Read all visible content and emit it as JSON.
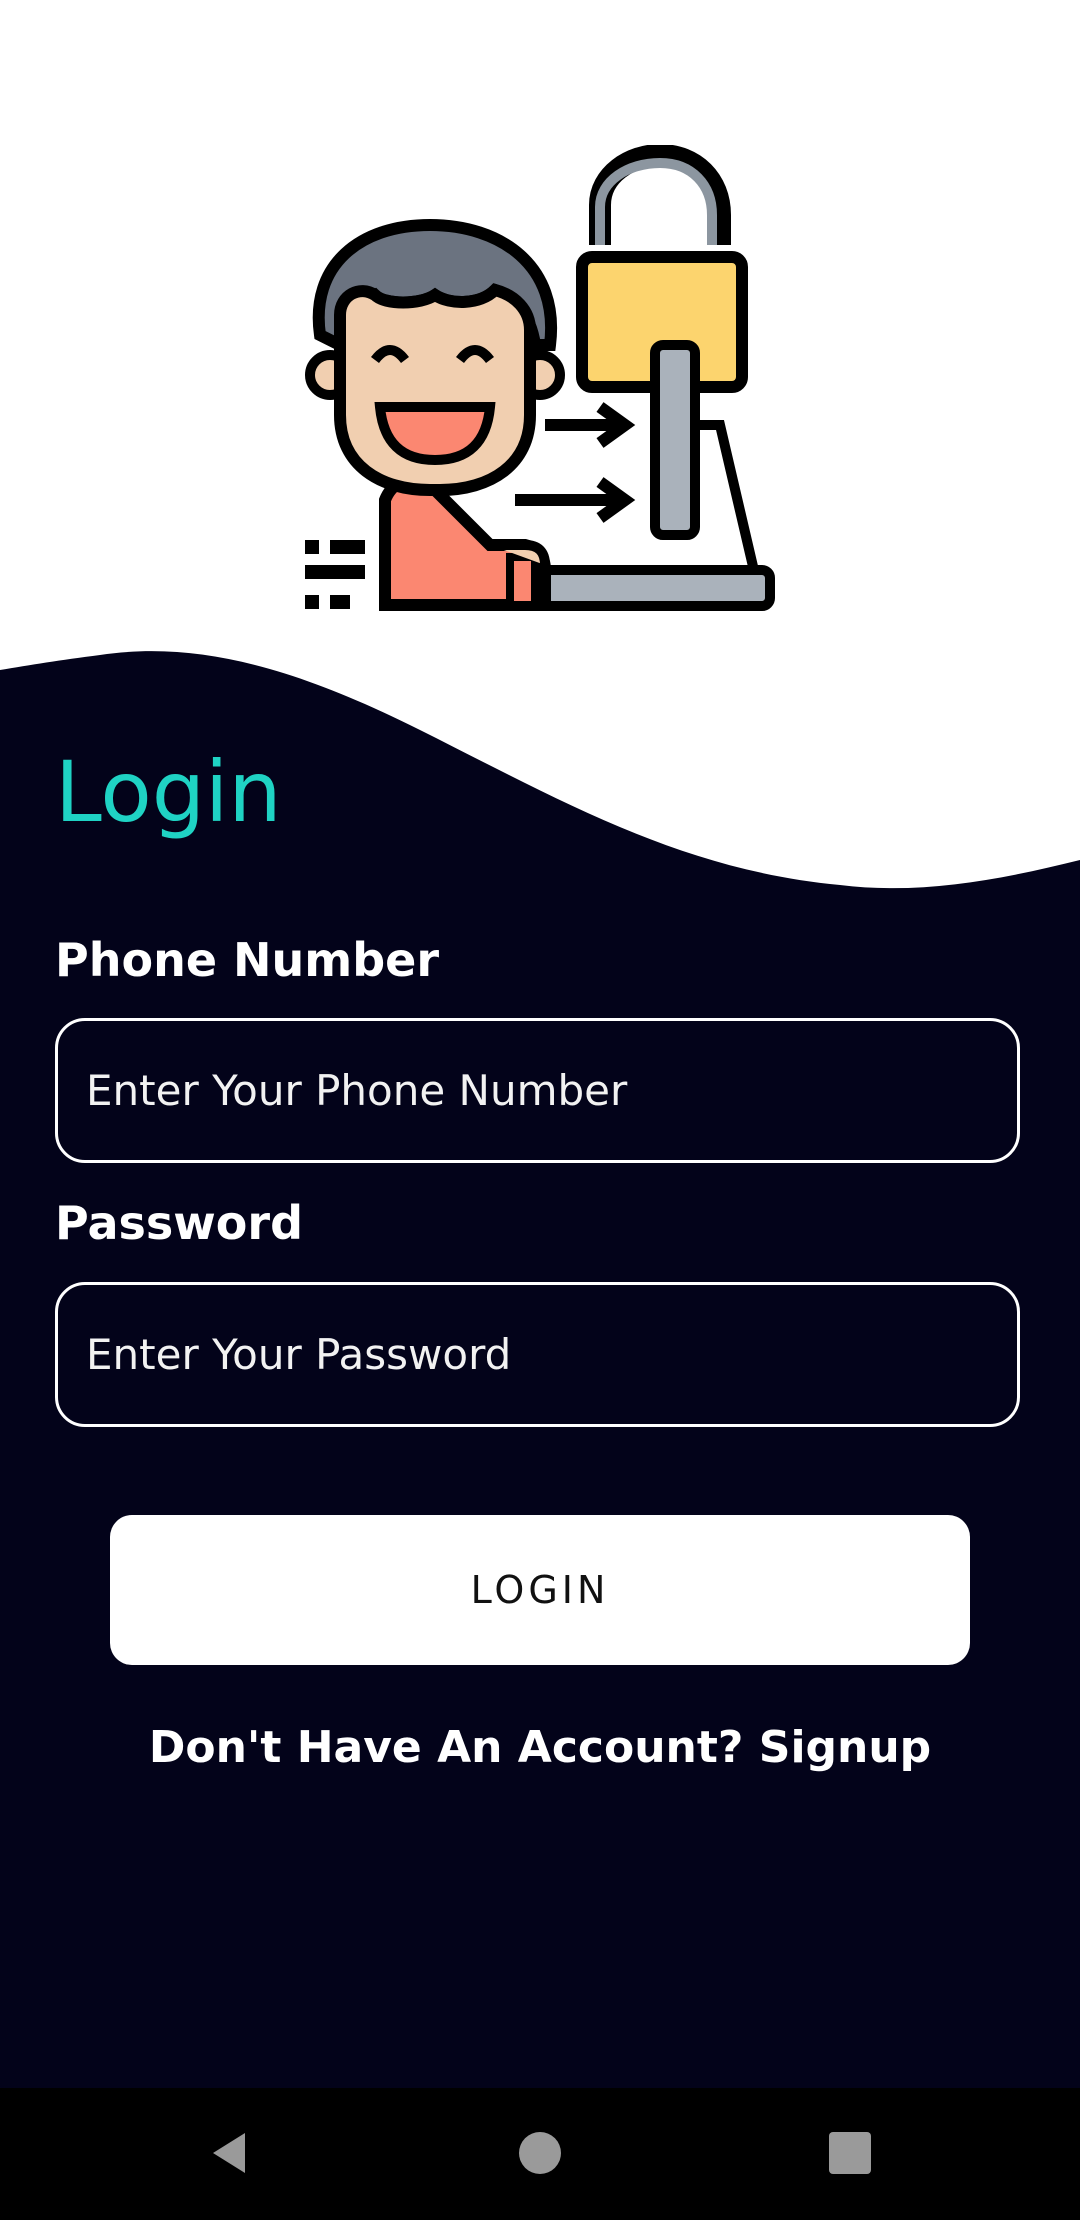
{
  "login": {
    "title": "Login",
    "phone_label": "Phone Number",
    "phone_placeholder": "Enter Your Phone Number",
    "password_label": "Password",
    "password_placeholder": "Enter Your Password",
    "button_label": "LOGIN",
    "signup_text": "Don't Have An Account? Signup"
  },
  "navbar": {
    "back_icon": "triangle-back-icon",
    "home_icon": "circle-home-icon",
    "recents_icon": "square-recents-icon"
  },
  "colors": {
    "background": "#03031a",
    "accent": "#1fd3c4",
    "white": "#ffffff",
    "navbar": "#000000"
  },
  "illustration": {
    "icon": "user-unlock-illustration-icon"
  }
}
